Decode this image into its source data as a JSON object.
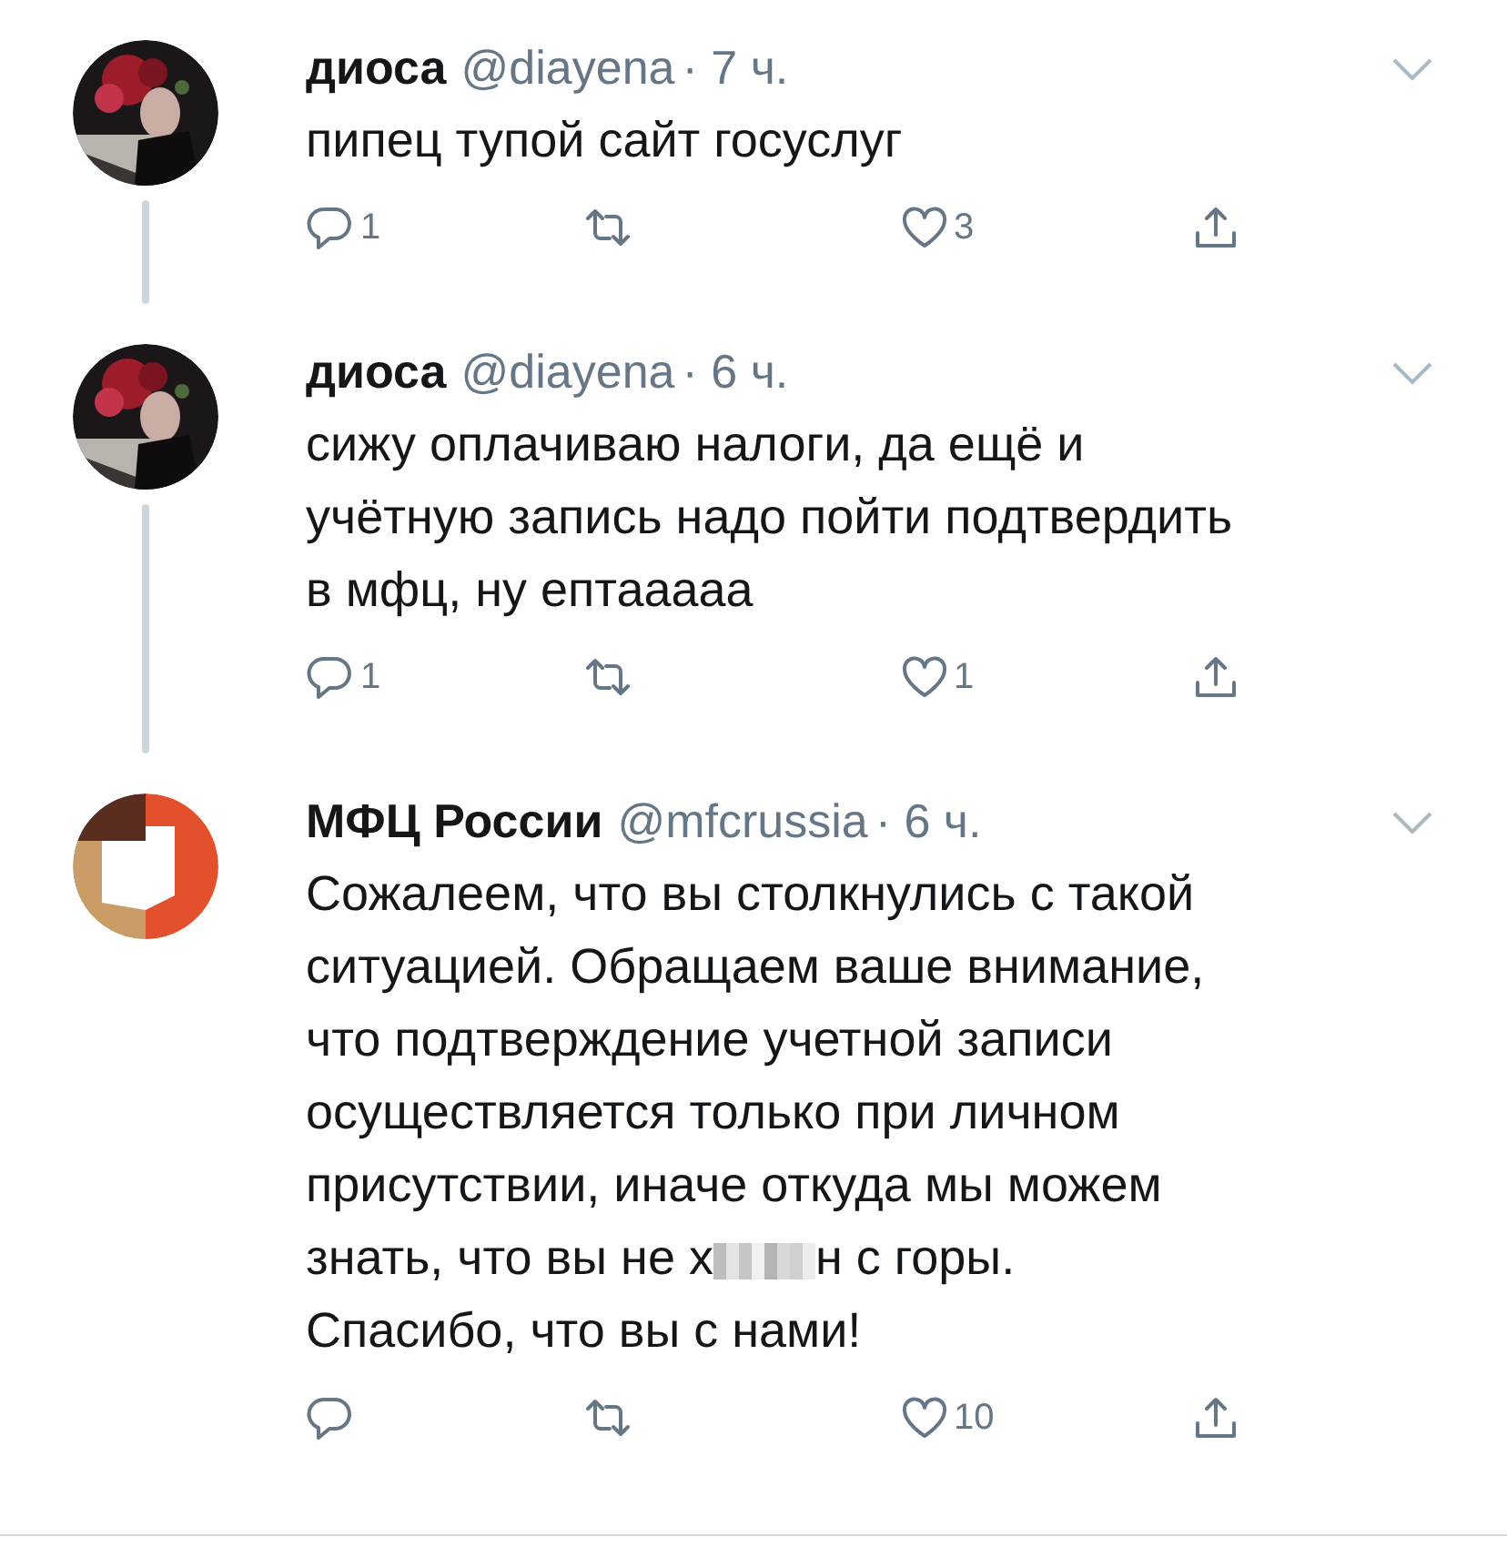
{
  "tweets": [
    {
      "name": "диоса",
      "handle": "@diayena",
      "time": "· 7 ч.",
      "thread_below": true,
      "segments": [
        {
          "kind": "text",
          "text": "пипец тупой сайт госуслуг"
        }
      ],
      "replies": "1",
      "likes": "3"
    },
    {
      "name": "диоса",
      "handle": "@diayena",
      "time": "· 6 ч.",
      "thread_below": true,
      "segments": [
        {
          "kind": "text",
          "text": "сижу оплачиваю налоги, да ещё и\nучётную запись надо пойти подтвердить\nв мфц, ну ептааааа"
        }
      ],
      "replies": "1",
      "likes": "1"
    },
    {
      "name": "МФЦ России",
      "handle": "@mfcrussia",
      "time": "· 6 ч.",
      "avatar": {
        "kind": "logo"
      },
      "thread_below": false,
      "segments": [
        {
          "kind": "text",
          "text": "Сожалеем, что вы столкнулись с такой\nситуацией. Обращаем ваше внимание,\nчто подтверждение учетной записи\nосуществляется только при личном\nприсутствии, иначе откуда мы можем"
        },
        {
          "kind": "inline",
          "text": "знать, что вы не х"
        },
        {
          "kind": "censored"
        },
        {
          "kind": "inline",
          "text": "н с горы."
        },
        {
          "kind": "text",
          "text": "Спасибо, что вы с нами!"
        }
      ],
      "likes": "10"
    }
  ]
}
